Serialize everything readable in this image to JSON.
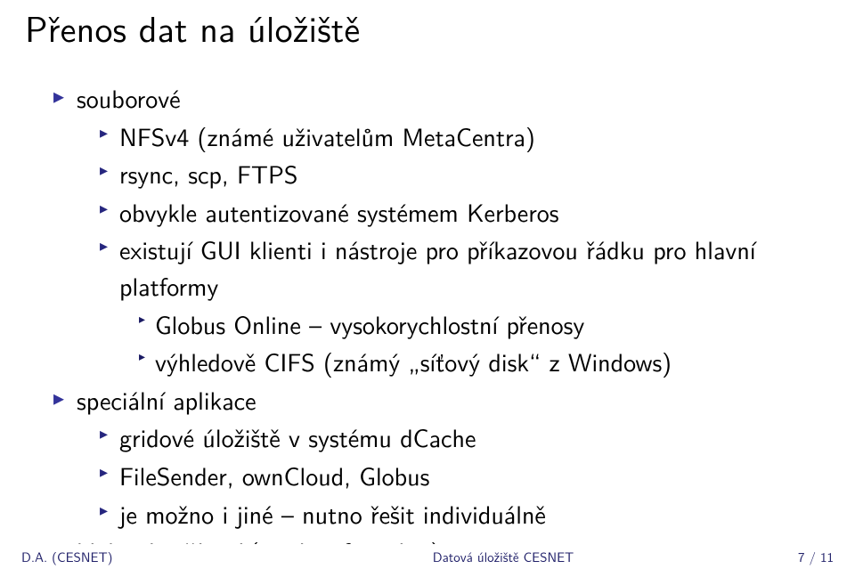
{
  "title": "Přenos dat na úložiště",
  "bullets": {
    "b1": {
      "label": "souborové",
      "s1": "NFSv4 (známé uživatelům MetaCentra)",
      "s2": "rsync, scp, FTPS",
      "s3": "obvykle autentizované systémem Kerberos",
      "s4": {
        "label": "existují GUI klienti i nástroje pro příkazovou řádku pro hlavní platformy",
        "t1": "Globus Online – vysokorychlostní přenosy",
        "t2": "výhledově CIFS (známý „síťový disk“ z Windows)"
      }
    },
    "b2": {
      "label": "speciální aplikace",
      "s1": "gridové úložiště v systému dCache",
      "s2": "FileSender, ownCloud, Globus",
      "s3": "je možno i jiné – nutno řešit individuálně"
    },
    "b3": {
      "label": "bloková zařízení (není preferováno)"
    }
  },
  "footer": {
    "author": "D.A. (CESNET)",
    "title": "Datová úložiště CESNET",
    "page": "7 / 11"
  }
}
